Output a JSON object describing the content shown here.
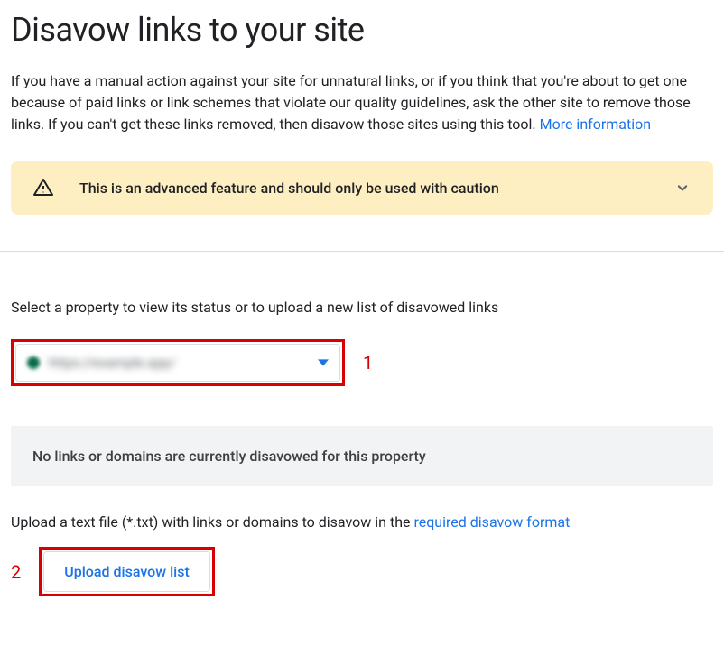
{
  "page": {
    "title": "Disavow links to your site",
    "intro": "If you have a manual action against your site for unnatural links, or if you think that you're about to get one because of paid links or link schemes that violate our quality guidelines, ask the other site to remove those links. If you can't get these links removed, then disavow those sites using this tool. ",
    "more_info": "More information"
  },
  "warning": {
    "text": "This is an advanced feature and should only be used with caution"
  },
  "select": {
    "label": "Select a property to view its status or to upload a new list of disavowed links",
    "value": "https://example.app/"
  },
  "annotations": {
    "num1": "1",
    "num2": "2"
  },
  "status": {
    "text": "No links or domains are currently disavowed for this property"
  },
  "upload": {
    "prefix": "Upload a text file (*.txt) with links or domains to disavow in the ",
    "link": "required disavow format",
    "button": "Upload disavow list"
  }
}
